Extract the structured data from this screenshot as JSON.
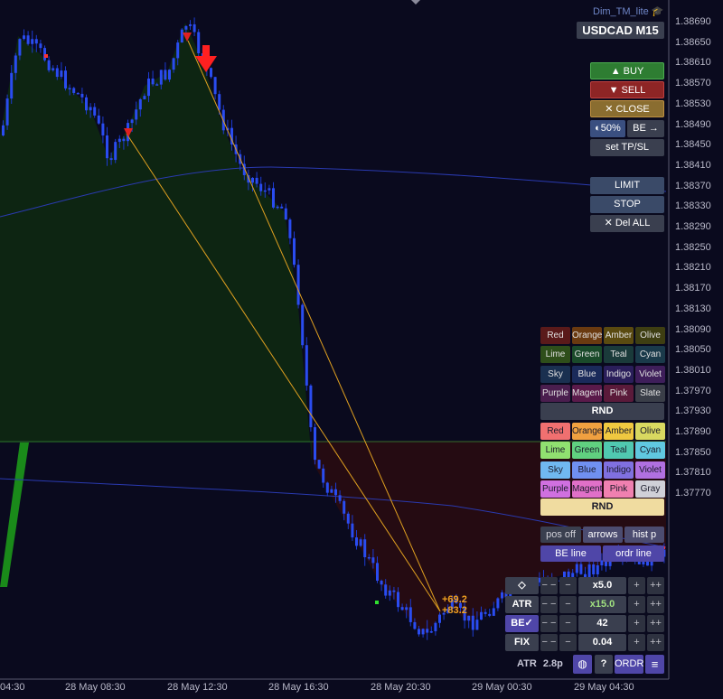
{
  "header": {
    "app_name": "Dim_TM_lite",
    "symbol_timeframe": "USDCAD M15"
  },
  "price_axis": [
    "1.38690",
    "1.38650",
    "1.38610",
    "1.38570",
    "1.38530",
    "1.38490",
    "1.38450",
    "1.38410",
    "1.38370",
    "1.38330",
    "1.38290",
    "1.38250",
    "1.38210",
    "1.38170",
    "1.38130",
    "1.38090",
    "1.38050",
    "1.38010",
    "1.37970",
    "1.37930",
    "1.37890",
    "1.37850",
    "1.37810",
    "1.37770"
  ],
  "time_axis": [
    "04:30",
    "28 May 08:30",
    "28 May 12:30",
    "28 May 16:30",
    "28 May 20:30",
    "29 May 00:30",
    "29 May 04:30"
  ],
  "trade": {
    "buy": "▲ BUY",
    "sell": "▼ SELL",
    "close": "✕ CLOSE",
    "half": "◐50%",
    "be": "BE →",
    "set_tpsl": "set TP/SL"
  },
  "orders": {
    "limit": "LIMIT",
    "stop": "STOP",
    "del_all": "✕ Del ALL"
  },
  "colors_dark": [
    "Red",
    "Orange",
    "Amber",
    "Olive",
    "Lime",
    "Green",
    "Teal",
    "Cyan",
    "Sky",
    "Blue",
    "Indigo",
    "Violet",
    "Purple",
    "Magenta",
    "Pink",
    "Slate"
  ],
  "colors_light": [
    "Red",
    "Orange",
    "Amber",
    "Olive",
    "Lime",
    "Green",
    "Teal",
    "Cyan",
    "Sky",
    "Blue",
    "Indigo",
    "Violet",
    "Purple",
    "Magenta",
    "Pink",
    "Gray"
  ],
  "rnd": "RND",
  "toggles": {
    "pos_off": "pos off",
    "arrows": "arrows",
    "hist_p": "hist p",
    "be_line": "BE line",
    "ordr_line": "ordr line"
  },
  "settings": {
    "rows": [
      {
        "label": "◇",
        "value": "x5.0"
      },
      {
        "label": "ATR",
        "value": "x15.0"
      },
      {
        "label": "BE✓",
        "value": "42"
      },
      {
        "label": "FIX",
        "value": "0.04"
      }
    ],
    "minus": "− −",
    "minus1": "−",
    "plus1": "+",
    "plus": "++"
  },
  "footer": {
    "atr_label": "ATR",
    "atr_value": "2.8p",
    "help": "?",
    "ordr": "ORDR",
    "menu": "≡"
  },
  "pl_labels": [
    "+69.2",
    "+83.2"
  ],
  "palette": {
    "dark": [
      "#5a1a1a",
      "#6a3a10",
      "#5a4a10",
      "#3e3e12",
      "#2e4e1a",
      "#1a4a2a",
      "#1a3a3a",
      "#1a3a4a",
      "#1a3050",
      "#1a2a5a",
      "#2a1e5a",
      "#3e1e5a",
      "#4a1e4e",
      "#5a1a4a",
      "#5a1a3a",
      "#3a3e48"
    ],
    "light": [
      "#f07070",
      "#f0a040",
      "#f0c840",
      "#d8d860",
      "#90e070",
      "#60d080",
      "#50c8b0",
      "#60c8e0",
      "#70b8f0",
      "#7090f0",
      "#8070e0",
      "#b070e0",
      "#d070e0",
      "#e070c8",
      "#f080b0",
      "#d0d0d8"
    ],
    "rnd_dark": "#3a3f4f",
    "rnd_light": "#f0dca0",
    "buy": "#2e7d32",
    "sell": "#8e2525",
    "close": "#8a6d30",
    "toggle": "#4c4c70",
    "toggle_active": "#4f46a8"
  }
}
